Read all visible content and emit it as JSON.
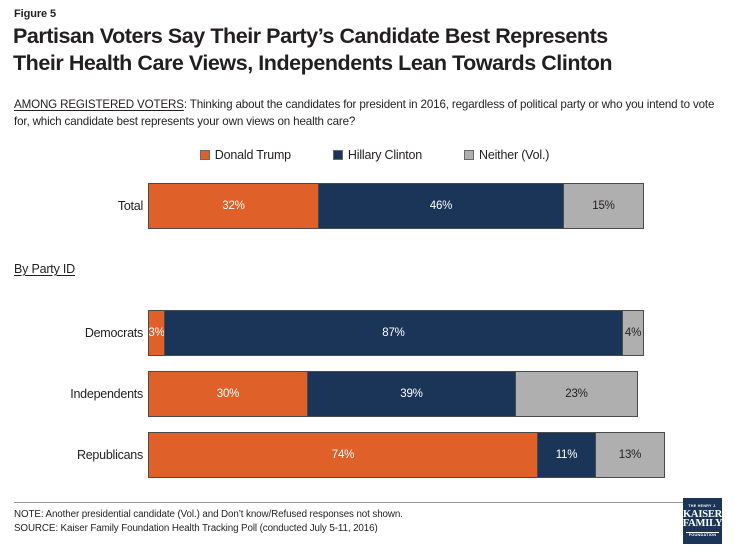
{
  "header": {
    "figure_label": "Figure 5",
    "title_line1": "Partisan Voters Say Their Party’s Candidate Best Represents",
    "title_line2": "Their Health Care Views, Independents Lean Towards Clinton"
  },
  "question": {
    "prefix": "AMONG REGISTERED VOTERS",
    "body": ": Thinking about the candidates for president in 2016, regardless of political party or who you intend to vote for, which candidate best represents your own views on health care?"
  },
  "legend": {
    "items": [
      {
        "label": "Donald Trump",
        "color": "#e0602a"
      },
      {
        "label": "Hillary Clinton",
        "color": "#1b3559"
      },
      {
        "label": "Neither (Vol.)",
        "color": "#afafaf"
      }
    ]
  },
  "group_label": "By Party ID",
  "rows": {
    "total": {
      "label": "Total",
      "trump": "32%",
      "clinton": "46%",
      "neither": "15%"
    },
    "democrats": {
      "label": "Democrats",
      "trump": "3%",
      "clinton": "87%",
      "neither": "4%"
    },
    "independents": {
      "label": "Independents",
      "trump": "30%",
      "clinton": "39%",
      "neither": "23%"
    },
    "republicans": {
      "label": "Republicans",
      "trump": "74%",
      "clinton": "11%",
      "neither": "13%"
    }
  },
  "footer": {
    "note": "NOTE: Another presidential candidate (Vol.) and Don’t know/Refused responses not shown.",
    "source": "SOURCE: Kaiser Family Foundation Health Tracking Poll (conducted July 5-11, 2016)"
  },
  "logo": {
    "top": "THE HENRY J.",
    "kaiser": "KAISER",
    "family": "FAMILY",
    "foundation": "FOUNDATION"
  },
  "chart_data": {
    "type": "bar",
    "orientation": "horizontal",
    "stacked": true,
    "title": "Partisan Voters Say Their Party’s Candidate Best Represents Their Health Care Views, Independents Lean Towards Clinton",
    "subtitle": "AMONG REGISTERED VOTERS: Thinking about the candidates for president in 2016, regardless of political party or who you intend to vote for, which candidate best represents your own views on health care?",
    "xlabel": "",
    "ylabel": "",
    "xlim": [
      0,
      100
    ],
    "grid": false,
    "legend_position": "top-center",
    "units": "percent",
    "categories": [
      "Total",
      "Democrats",
      "Independents",
      "Republicans"
    ],
    "category_groups": [
      {
        "name": "",
        "categories": [
          "Total"
        ]
      },
      {
        "name": "By Party ID",
        "categories": [
          "Democrats",
          "Independents",
          "Republicans"
        ]
      }
    ],
    "series": [
      {
        "name": "Donald Trump",
        "color": "#e0602a",
        "values": [
          32,
          3,
          30,
          74
        ]
      },
      {
        "name": "Hillary Clinton",
        "color": "#1b3559",
        "values": [
          46,
          87,
          39,
          11
        ]
      },
      {
        "name": "Neither (Vol.)",
        "color": "#afafaf",
        "values": [
          15,
          4,
          23,
          13
        ]
      }
    ],
    "data_labels": [
      {
        "category": "Total",
        "Donald Trump": "32%",
        "Hillary Clinton": "46%",
        "Neither (Vol.)": "15%"
      },
      {
        "category": "Democrats",
        "Donald Trump": "3%",
        "Hillary Clinton": "87%",
        "Neither (Vol.)": "4%"
      },
      {
        "category": "Independents",
        "Donald Trump": "30%",
        "Hillary Clinton": "39%",
        "Neither (Vol.)": "23%"
      },
      {
        "category": "Republicans",
        "Donald Trump": "74%",
        "Hillary Clinton": "11%",
        "Neither (Vol.)": "13%"
      }
    ],
    "annotations": [
      "NOTE: Another presidential candidate (Vol.) and Don’t know/Refused responses not shown.",
      "SOURCE: Kaiser Family Foundation Health Tracking Poll (conducted July 5-11, 2016)"
    ]
  }
}
